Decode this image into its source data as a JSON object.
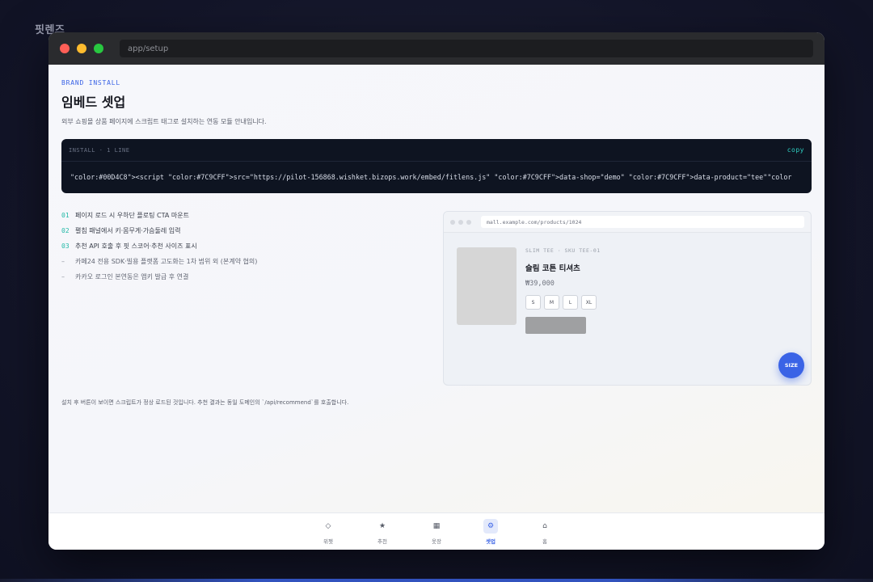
{
  "app": {
    "name": "핏렌즈"
  },
  "browser": {
    "url": "app/setup"
  },
  "page": {
    "kicker": "BRAND INSTALL",
    "title": "임베드 셋업",
    "subtitle": "외부 쇼핑몰 상품 페이지에 스크립트 태그로 설치하는 연동 모듈 안내입니다."
  },
  "install": {
    "header": "INSTALL · 1 LINE",
    "copy_label": "copy",
    "code": "\"color:#00D4C8\"><script \"color:#7C9CFF\">src=\"https://pilot-156868.wishket.bizops.work/embed/fitlens.js\" \"color:#7C9CFF\">data-shop=\"demo\" \"color:#7C9CFF\">data-product=\"tee\"\"color"
  },
  "steps": [
    {
      "num": "01",
      "text": "페이지 로드 시 우하단 플로팅 CTA 마운트"
    },
    {
      "num": "02",
      "text": "펼침 패널에서 키·몸무게·가슴둘레 입력"
    },
    {
      "num": "03",
      "text": "추천 API 호출 후 핏 스코어·추천 사이즈 표시"
    }
  ],
  "notes": [
    {
      "mark": "–",
      "text": "카페24 전용 SDK·빌용 플랫폼 고도화는 1차 범위 외 (본계약 협의)"
    },
    {
      "mark": "–",
      "text": "카카오 로그인 본연동은 앱키 발급 후 연결"
    }
  ],
  "preview": {
    "url": "mall.example.com/products/1024",
    "sku": "SLIM TEE · SKU TEE-01",
    "product_name": "슬림 코튼 티셔츠",
    "price": "₩39,000",
    "sizes": [
      "S",
      "M",
      "L",
      "XL"
    ],
    "fab_label": "SIZE"
  },
  "footnote": "설치 후 버튼이 보이면 스크립트가 정상 로드된 것입니다. 추천 결과는 동일 도메인의 `/api/recommend`를 호출합니다.",
  "tabs": [
    {
      "icon": "◇",
      "label": "위젯",
      "active": false
    },
    {
      "icon": "★",
      "label": "추천",
      "active": false
    },
    {
      "icon": "▦",
      "label": "옷장",
      "active": false
    },
    {
      "icon": "⚙",
      "label": "셋업",
      "active": true
    },
    {
      "icon": "⌂",
      "label": "홈",
      "active": false
    }
  ],
  "colors": {
    "accent": "#3a63e6",
    "teal": "#22b8a6",
    "code_bg": "#0e1421"
  }
}
